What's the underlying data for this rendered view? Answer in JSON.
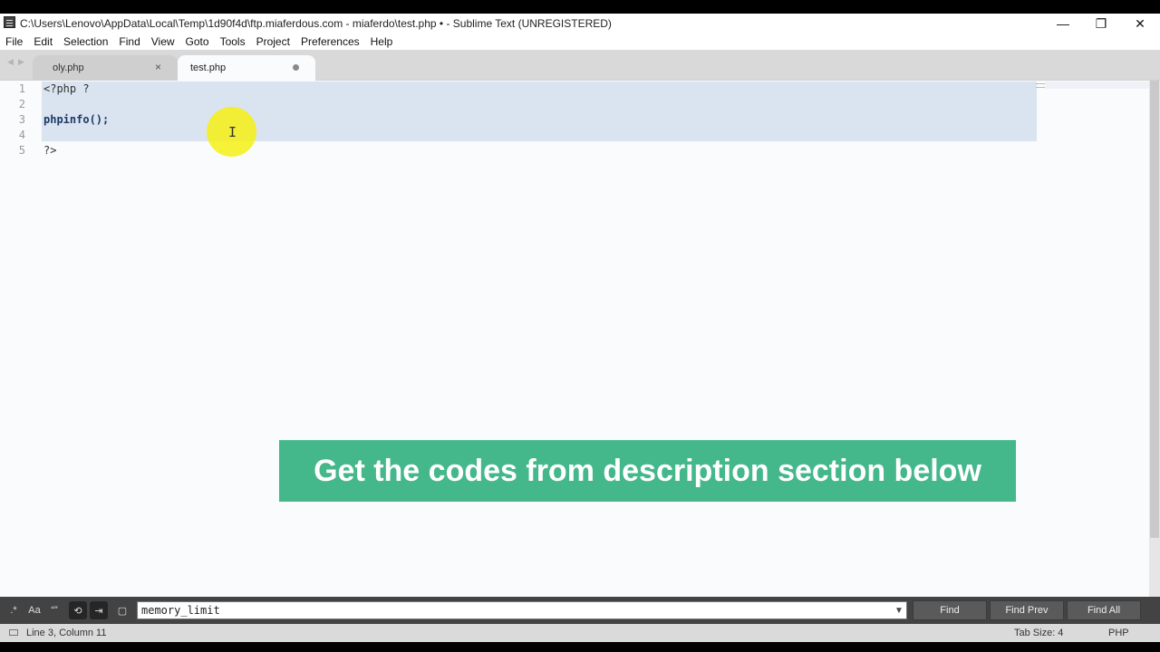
{
  "window": {
    "title": "C:\\Users\\Lenovo\\AppData\\Local\\Temp\\1d90f4d\\ftp.miaferdous.com - miaferdo\\test.php • - Sublime Text (UNREGISTERED)",
    "minimize_glyph": "—",
    "restore_glyph": "❐",
    "close_glyph": "✕"
  },
  "menu": [
    "File",
    "Edit",
    "Selection",
    "Find",
    "View",
    "Goto",
    "Tools",
    "Project",
    "Preferences",
    "Help"
  ],
  "tabs": [
    {
      "label": "oly.php",
      "close_glyph": "×"
    },
    {
      "label": "test.php"
    }
  ],
  "nav": {
    "back": "◀",
    "forward": "▶"
  },
  "editor": {
    "line_numbers": [
      "1",
      "2",
      "3",
      "4",
      "5"
    ],
    "lines": [
      "<?php ?",
      "",
      "phpinfo();",
      "",
      "?>"
    ],
    "cursor_glyph": "I"
  },
  "overlay": {
    "banner_text": "Get the codes from description section below",
    "accent": "#44b88a",
    "highlight": "#f5f014"
  },
  "find_panel": {
    "toggles": [
      ".*",
      "Aa",
      "“”",
      "⟲",
      "⇥",
      "▢"
    ],
    "query": "memory_limit",
    "dropdown_glyph": "▼",
    "buttons": [
      "Find",
      "Find Prev",
      "Find All"
    ]
  },
  "status": {
    "position": "Line 3, Column 11",
    "tab_size": "Tab Size: 4",
    "syntax": "PHP"
  }
}
